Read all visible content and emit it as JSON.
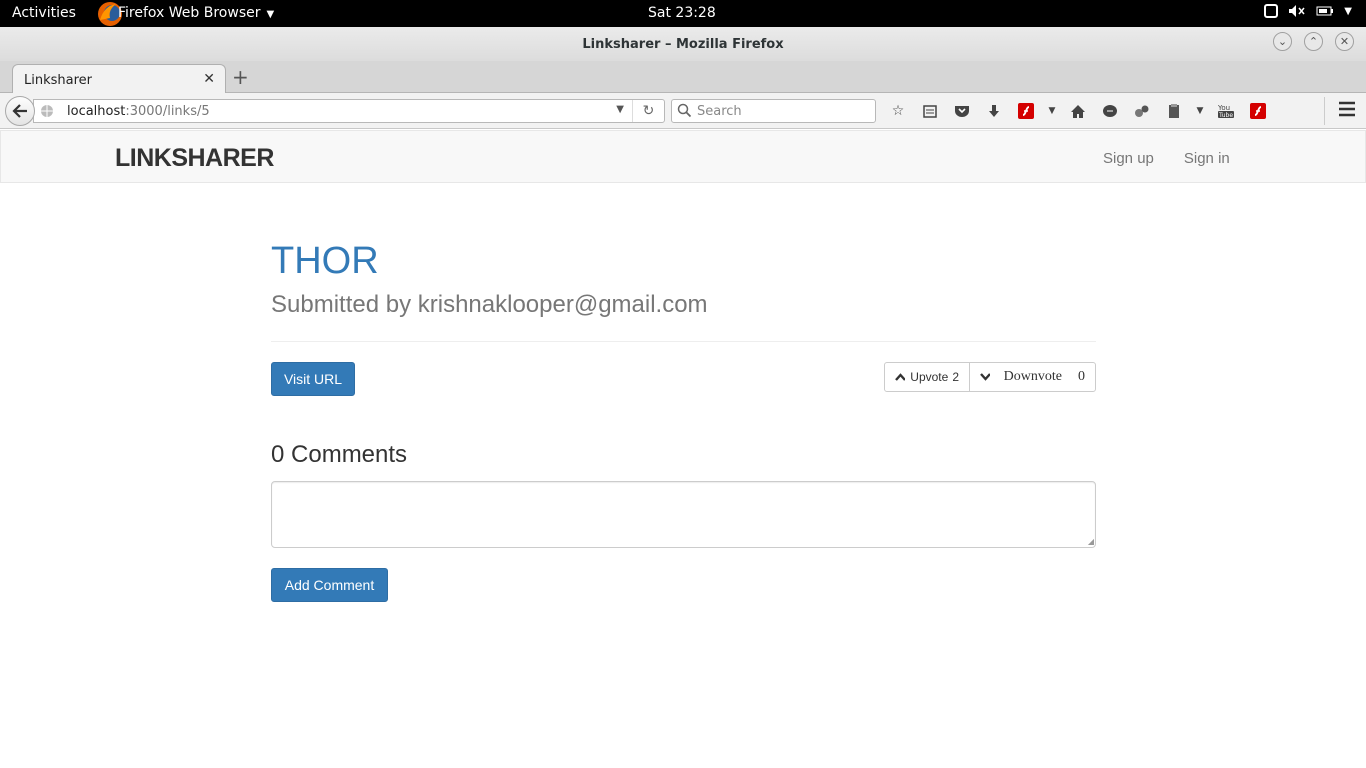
{
  "system": {
    "activities": "Activities",
    "app_name": "Firefox Web Browser",
    "clock": "Sat 23:28"
  },
  "window": {
    "title": "Linksharer – Mozilla Firefox"
  },
  "browser": {
    "tab_label": "Linksharer",
    "url_host": "localhost",
    "url_rest": ":3000/links/5",
    "search_placeholder": "Search"
  },
  "site": {
    "brand": "LINKSHARER",
    "nav": {
      "signup": "Sign up",
      "signin": "Sign in"
    }
  },
  "link": {
    "title": "THOR",
    "submitted_by": "Submitted by krishnaklooper@gmail.com",
    "visit_label": "Visit URL",
    "upvote_label": "Upvote",
    "upvote_count": "2",
    "downvote_label": "Downvote",
    "downvote_count": "0"
  },
  "comments": {
    "heading": "0 Comments",
    "textarea_value": "",
    "add_label": "Add Comment"
  },
  "colors": {
    "accent": "#337ab7",
    "topbar": "#000000"
  }
}
